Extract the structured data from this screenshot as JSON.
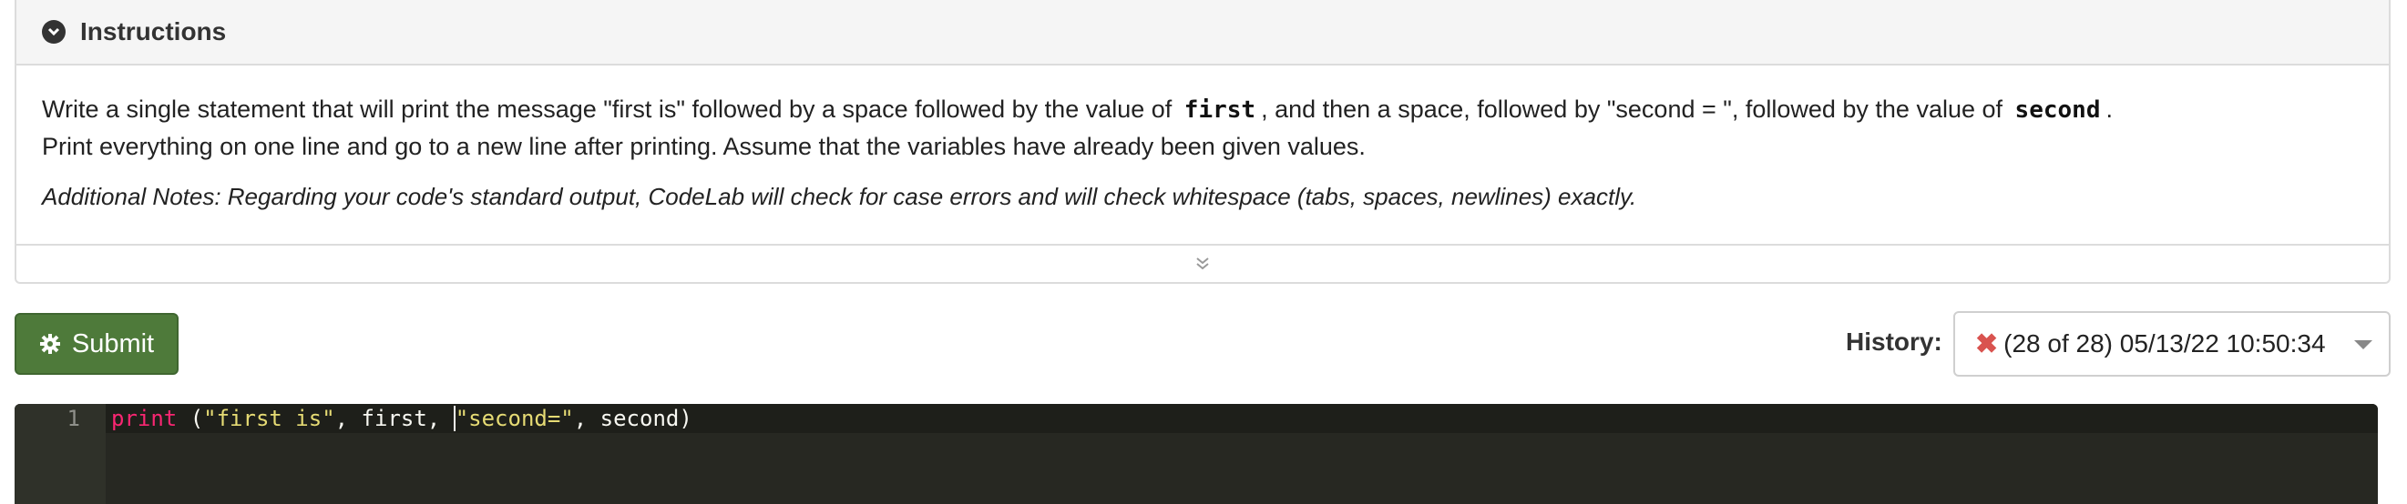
{
  "instructions": {
    "title": "Instructions",
    "line1_before_first": "Write a single statement that will print the message \"first is\"  followed by a space followed by the value of",
    "code_first": "first",
    "line1_middle": ", and then a space, followed by \"second = \", followed by the value of",
    "code_second": "second",
    "line1_end": ".",
    "line2": "Print everything on one line and go to a new line after printing. Assume that the variables have already been given values.",
    "notes": "Additional Notes: Regarding your code's standard output, CodeLab will check for case errors and will check whitespace (tabs, spaces, newlines) exactly."
  },
  "submit": {
    "label": "Submit"
  },
  "history": {
    "label": "History:",
    "selected": "(28 of 28) 05/13/22 10:50:34",
    "status_icon": "x-icon",
    "status_color": "#d9534f"
  },
  "editor": {
    "line_number": "1",
    "tokens": {
      "keyword": "print",
      "open": " (",
      "str1": "\"first is\"",
      "mid": ", first, ",
      "str2": "\"second=\"",
      "end": ", second)"
    }
  },
  "colors": {
    "submit_green": "#4e7a3a",
    "editor_bg": "#272822"
  }
}
